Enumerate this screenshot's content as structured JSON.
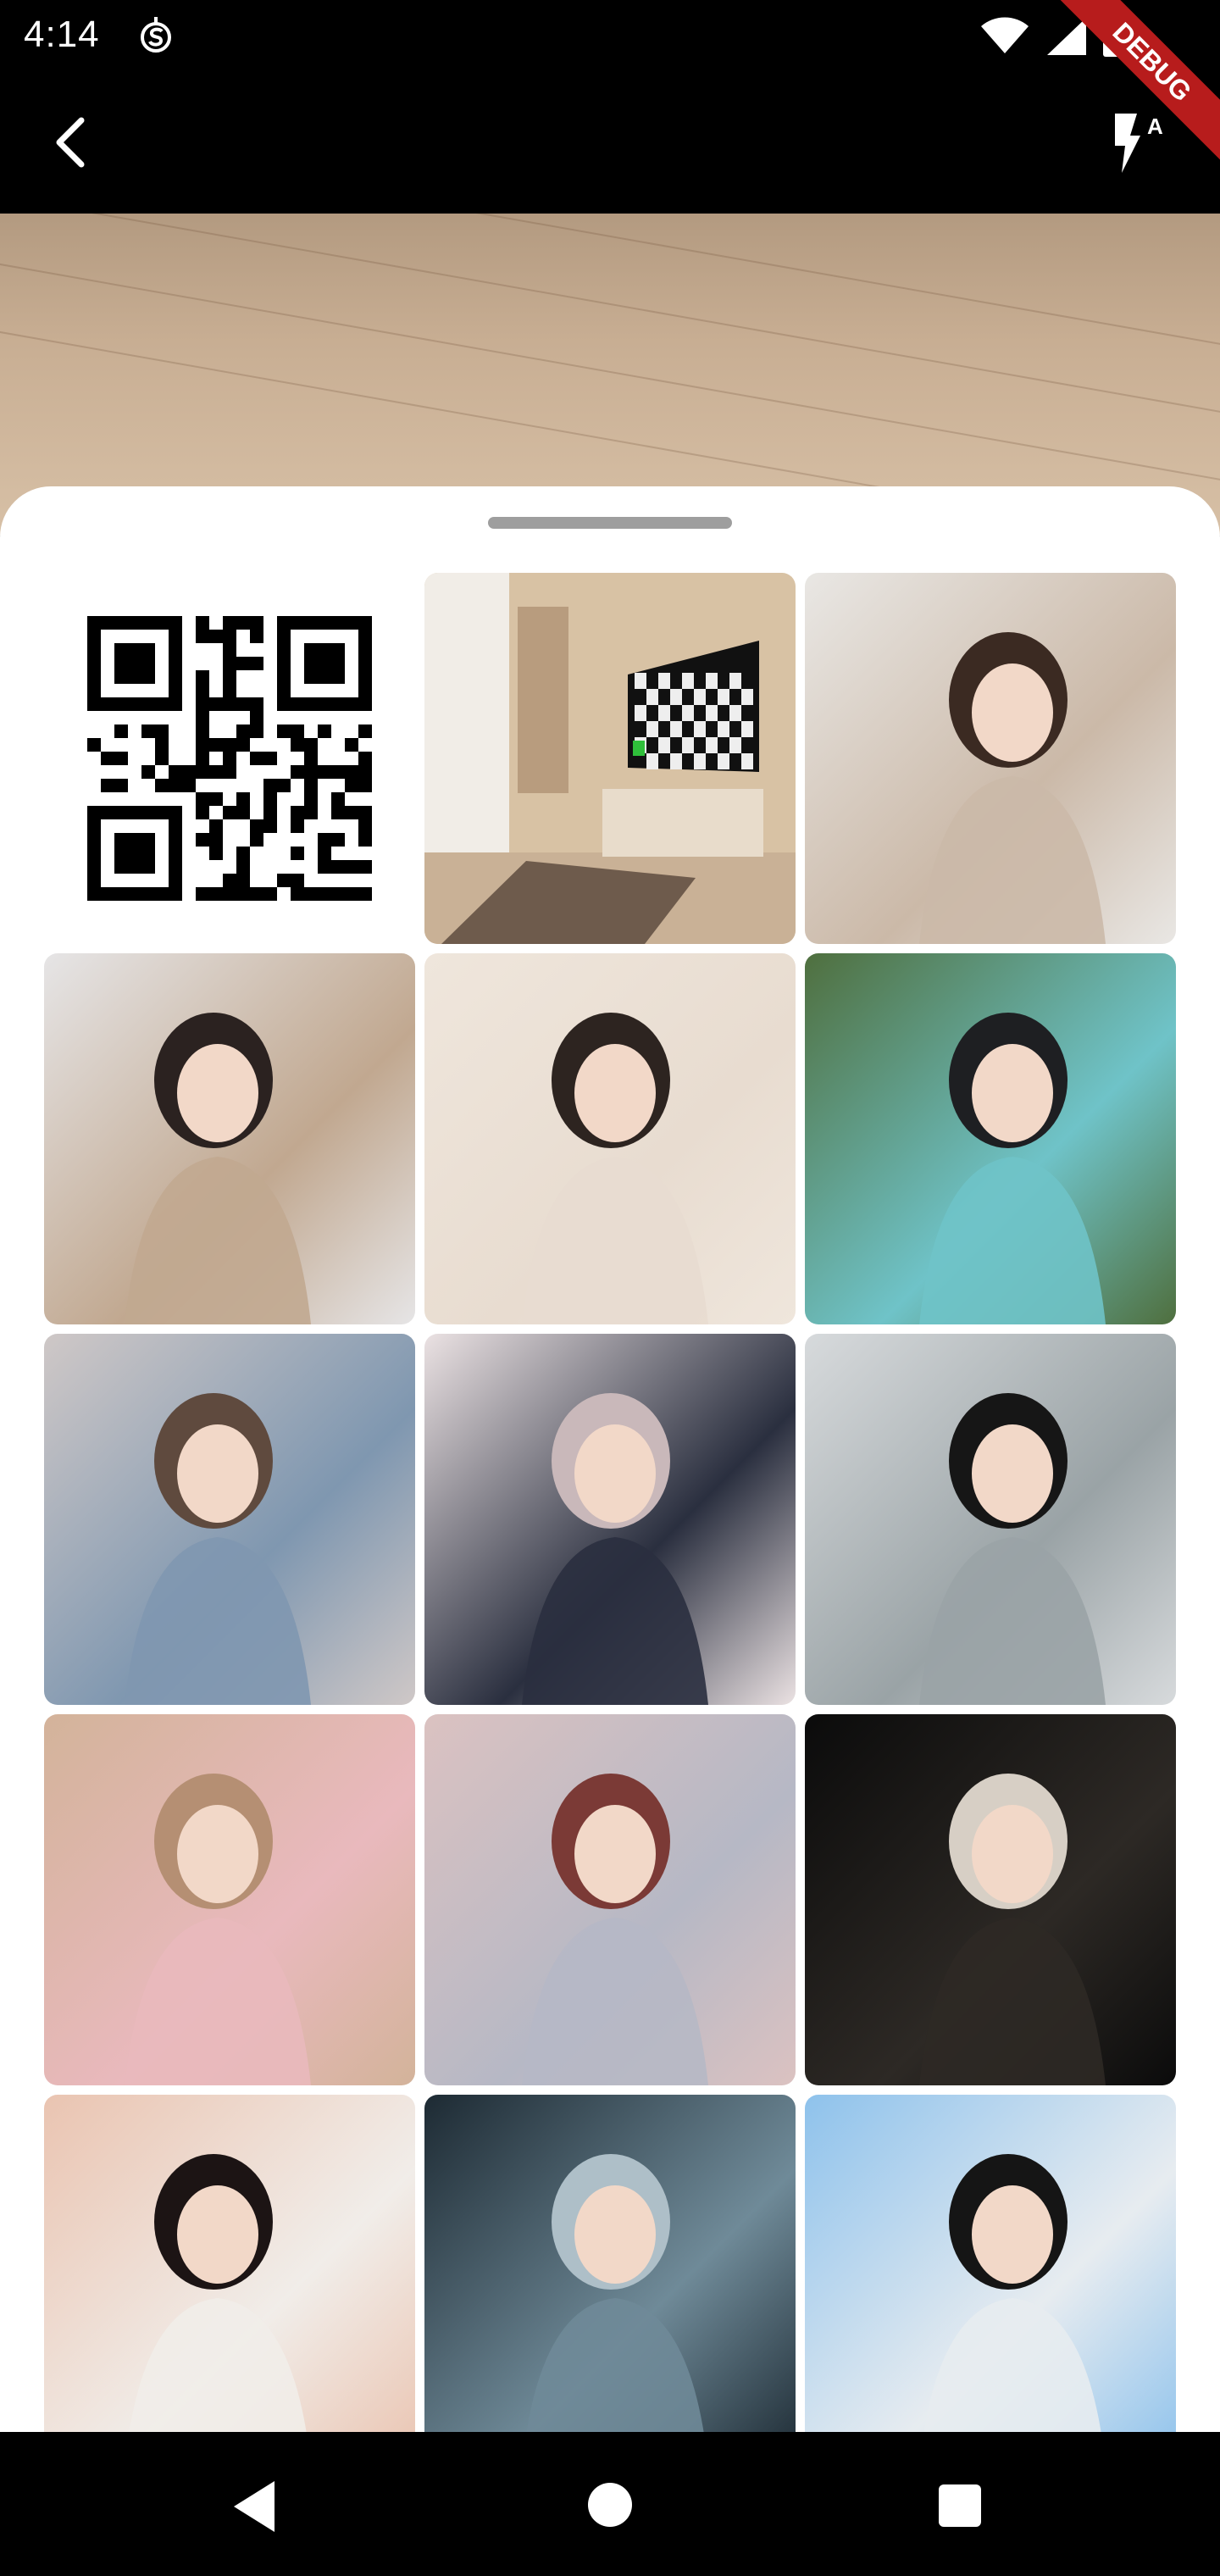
{
  "status_bar": {
    "time": "4:14",
    "icons": [
      "s-circle-icon",
      "wifi-icon",
      "signal-icon",
      "battery-icon"
    ]
  },
  "debug_banner": {
    "label": "DEBUG"
  },
  "app_bar": {
    "back_icon": "chevron-left-icon",
    "flash_icon": "flash-auto-icon",
    "flash_label": "A"
  },
  "sheet": {
    "grid": [
      {
        "type": "qr",
        "name": "qr-code"
      },
      {
        "type": "photo",
        "name": "room-with-tv",
        "colors": [
          "#d8c2a4",
          "#f1ede7",
          "#8a7460"
        ]
      },
      {
        "type": "photo",
        "name": "girl-floral-dress",
        "colors": [
          "#e9e7e4",
          "#cbb9a8",
          "#3b2a22"
        ]
      },
      {
        "type": "photo",
        "name": "girl-mirror-selfie",
        "colors": [
          "#e6e5e6",
          "#c1a890",
          "#2b2220"
        ]
      },
      {
        "type": "photo",
        "name": "girl-white-shirt",
        "colors": [
          "#efe6dc",
          "#e8dcd0",
          "#2d2420"
        ]
      },
      {
        "type": "photo",
        "name": "girl-by-pool",
        "colors": [
          "#4f6f3e",
          "#6fc3c8",
          "#1e1f22"
        ]
      },
      {
        "type": "photo",
        "name": "girl-denim-overalls",
        "colors": [
          "#cfc8c7",
          "#7f97b0",
          "#5f4a3e"
        ]
      },
      {
        "type": "photo",
        "name": "girl-school-uniform",
        "colors": [
          "#ebe2e3",
          "#2a2f3f",
          "#c9b8ba"
        ]
      },
      {
        "type": "photo",
        "name": "girl-black-dress-railing",
        "colors": [
          "#d7dadc",
          "#9aa3a6",
          "#161616"
        ]
      },
      {
        "type": "photo",
        "name": "two-girls-pink-dresses",
        "colors": [
          "#d3b39a",
          "#e9b9bd",
          "#b58f73"
        ]
      },
      {
        "type": "photo",
        "name": "girl-on-pillow",
        "colors": [
          "#dbc2c1",
          "#b6b8c5",
          "#7b3a36"
        ]
      },
      {
        "type": "photo",
        "name": "girl-dark-background",
        "colors": [
          "#0b0b0b",
          "#2d2925",
          "#d7cfc5"
        ]
      },
      {
        "type": "photo",
        "name": "girl-closeup-lying",
        "colors": [
          "#eac4b1",
          "#f1ede9",
          "#1c1414"
        ]
      },
      {
        "type": "photo",
        "name": "girl-hanfu-night",
        "colors": [
          "#1d2a33",
          "#6f8a98",
          "#aebfc8"
        ]
      },
      {
        "type": "photo",
        "name": "girl-black-hoodie",
        "colors": [
          "#8ec2ec",
          "#e7ecf0",
          "#151515"
        ]
      }
    ]
  },
  "nav_bar": {
    "back_icon": "nav-back-triangle-icon",
    "home_icon": "nav-home-circle-icon",
    "recents_icon": "nav-recents-square-icon"
  }
}
